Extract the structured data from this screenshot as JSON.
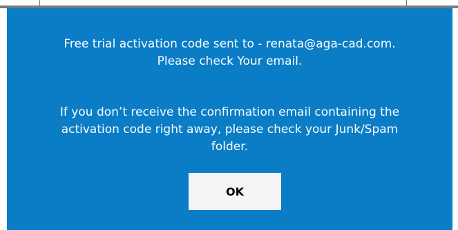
{
  "dialog": {
    "message_line_1": "Free trial activation code sent to - renata@aga-cad.com.",
    "message_line_2": "Please check Your email.",
    "message_line_3": "If you don’t receive the confirmation email containing the",
    "message_line_4": "activation code right away, please check your Junk/Spam",
    "message_line_5": "folder.",
    "ok_label": "OK"
  },
  "colors": {
    "dialog_background": "#0a7dc6",
    "text": "#ffffff",
    "button_background": "#f4f4f4"
  }
}
